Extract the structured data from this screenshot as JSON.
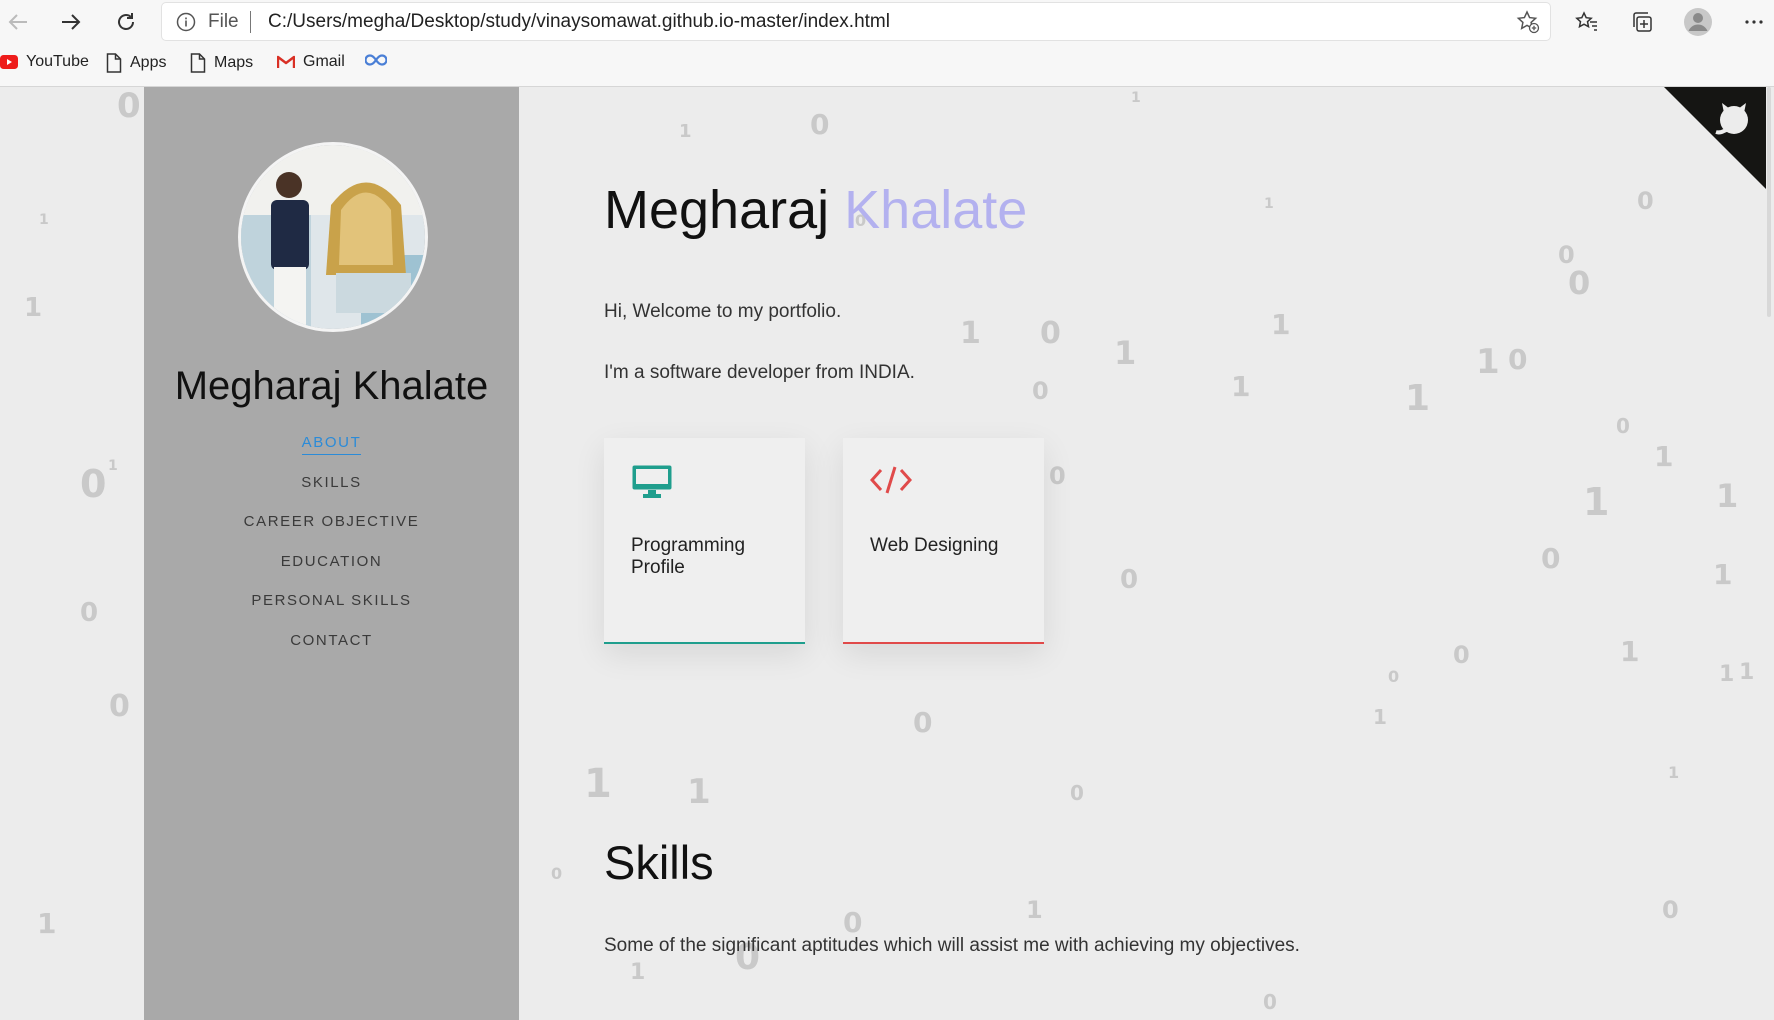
{
  "browser": {
    "protocol_label": "File",
    "url": "C:/Users/megha/Desktop/study/vinaysomawat.github.io-master/index.html",
    "bookmarks": [
      {
        "label": "YouTube",
        "icon": "youtube-icon"
      },
      {
        "label": "Apps",
        "icon": "page-icon"
      },
      {
        "label": "Maps",
        "icon": "page-icon"
      },
      {
        "label": "Gmail",
        "icon": "gmail-icon"
      },
      {
        "label": "",
        "icon": "infinity-icon"
      }
    ]
  },
  "sidebar": {
    "name": "Megharaj Khalate",
    "nav": [
      {
        "label": "ABOUT",
        "active": true
      },
      {
        "label": "SKILLS",
        "active": false
      },
      {
        "label": "CAREER OBJECTIVE",
        "active": false
      },
      {
        "label": "EDUCATION",
        "active": false
      },
      {
        "label": "PERSONAL SKILLS",
        "active": false
      },
      {
        "label": "CONTACT",
        "active": false
      }
    ]
  },
  "main": {
    "first_name": "Megharaj",
    "last_name": "Khalate",
    "intro_line1": "Hi, Welcome to my portfolio.",
    "intro_line2": "I'm a software developer from INDIA.",
    "cards": [
      {
        "title": "Programming Profile",
        "icon": "monitor-icon",
        "accent": "#1f9e8d"
      },
      {
        "title": "Web Designing",
        "icon": "code-icon",
        "accent": "#e04a4a"
      }
    ],
    "skills_heading": "Skills",
    "skills_text": "Some of the significant aptitudes which will assist me with achieving my objectives."
  },
  "colors": {
    "accent_lastname": "#b3b1ef",
    "nav_active": "#2b8bd8",
    "sidebar_bg": "#a9a9a9"
  },
  "background_digits": [
    "0",
    "1",
    "0",
    "1",
    "1",
    "0",
    "1",
    "0",
    "1",
    "0",
    "0",
    "1",
    "1",
    "0",
    "1",
    "1",
    "0",
    "1",
    "1",
    "0",
    "0",
    "1",
    "0",
    "1",
    "1",
    "0",
    "1",
    "0",
    "1",
    "0",
    "0",
    "1",
    "0",
    "1",
    "0",
    "1",
    "0",
    "1",
    "0",
    "0",
    "1",
    "1",
    "0",
    "1",
    "0",
    "1",
    "0",
    "0",
    "1",
    "0",
    "1",
    "0",
    "1",
    "0",
    "0",
    "0"
  ]
}
